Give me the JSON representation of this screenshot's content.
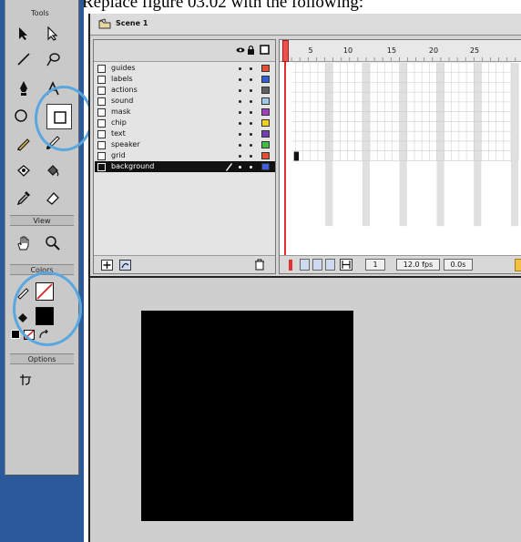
{
  "caption": "Replace figure 03.02 with the following:",
  "tools_panel": {
    "title": "Tools",
    "sections": {
      "view": "View",
      "colors": "Colors",
      "options": "Options"
    },
    "icons": [
      "arrow-icon",
      "subselect-icon",
      "line-icon",
      "lasso-icon",
      "pen-icon",
      "text-icon",
      "oval-icon",
      "rectangle-icon",
      "pencil-icon",
      "brush-icon",
      "ink-bottle-icon",
      "paint-bucket-icon",
      "eyedropper-icon",
      "eraser-icon",
      "hand-icon",
      "zoom-icon",
      "stroke-color-icon",
      "fill-color-icon",
      "swap-colors-icon",
      "snap-icon"
    ],
    "selected_tool": "rectangle-icon"
  },
  "timeline": {
    "scene_label": "Scene 1",
    "layers": [
      {
        "name": "guides",
        "color": "#e05030"
      },
      {
        "name": "labels",
        "color": "#3060d0"
      },
      {
        "name": "actions",
        "color": "#606060"
      },
      {
        "name": "sound",
        "color": "#a0c8e8"
      },
      {
        "name": "mask",
        "color": "#a040c0"
      },
      {
        "name": "chip",
        "color": "#f0d020"
      },
      {
        "name": "text",
        "color": "#7040b0"
      },
      {
        "name": "speaker",
        "color": "#40c040"
      },
      {
        "name": "grid",
        "color": "#e05030"
      },
      {
        "name": "background",
        "color": "#4060e0",
        "active": true
      }
    ],
    "frame_numbers": [
      "5",
      "10",
      "15",
      "20",
      "25"
    ],
    "status": {
      "current_frame": "1",
      "frame_rate": "12.0 fps",
      "elapsed_time": "0.0s"
    }
  },
  "colors": {
    "accent_circle": "#5aa7e0",
    "playhead": "#e03030",
    "stage_rect": "#000000"
  }
}
